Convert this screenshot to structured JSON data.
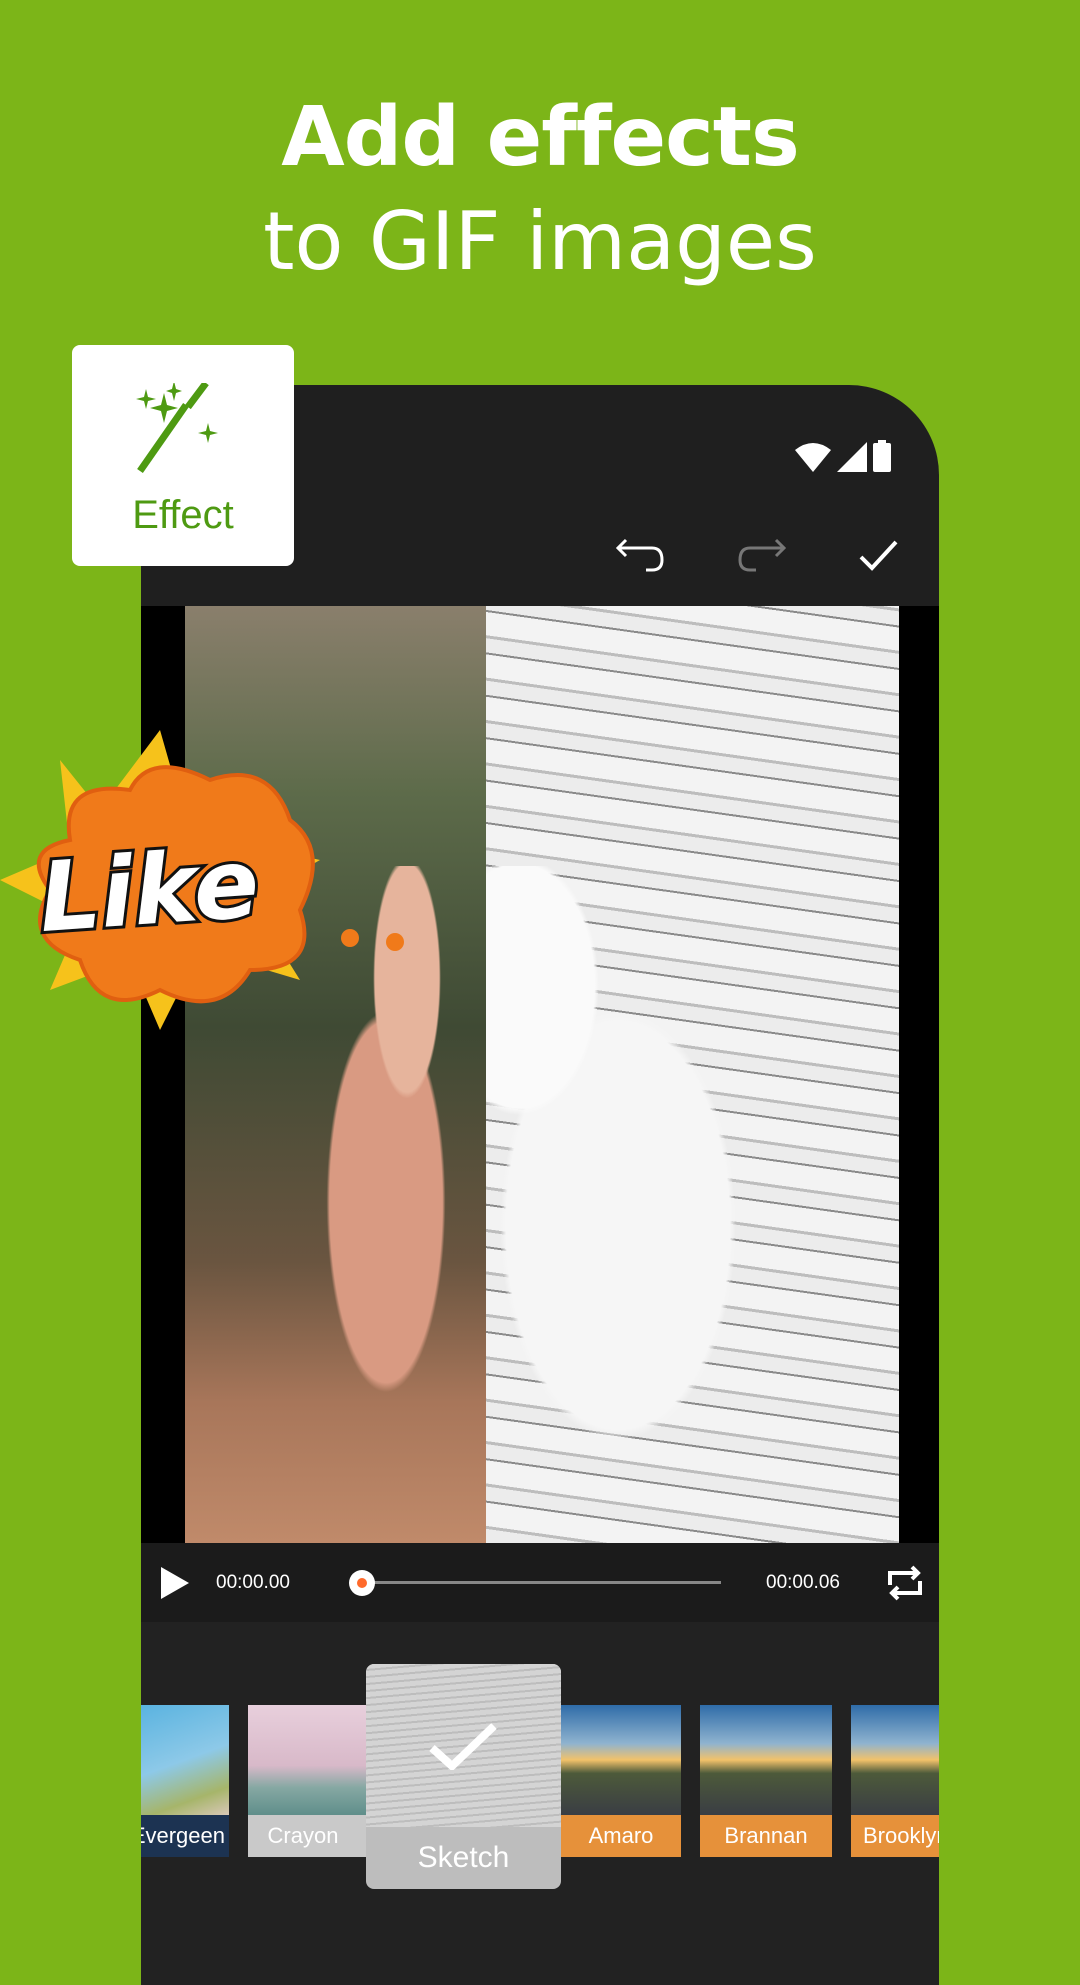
{
  "headline": {
    "line1": "Add effects",
    "line2": "to GIF images"
  },
  "badge": {
    "label": "Effect",
    "icon": "magic-wand-icon",
    "color": "#4e9a12"
  },
  "status_bar": {
    "icons": [
      "wifi-icon",
      "signal-icon",
      "battery-icon"
    ]
  },
  "toolbar": {
    "icons": [
      "undo-icon",
      "redo-icon",
      "check-icon"
    ]
  },
  "sticker": {
    "text": "Like"
  },
  "player": {
    "current_time": "00:00.00",
    "total_time": "00:00.06",
    "progress": 0,
    "accent": "#ff6a2b"
  },
  "filters": {
    "items": [
      {
        "label": "Evergeen",
        "color": "#1c3352"
      },
      {
        "label": "Crayon",
        "color": "#c9c9c9"
      },
      {
        "label": "Sketch",
        "color": "#c4c4c4",
        "selected": true
      },
      {
        "label": "Amaro",
        "color": "#e6913a"
      },
      {
        "label": "Brannan",
        "color": "#e6913a"
      },
      {
        "label": "Brooklyn",
        "color": "#e6913a"
      }
    ]
  },
  "colors": {
    "background": "#7cb518",
    "phone": "#1f1f1f"
  }
}
